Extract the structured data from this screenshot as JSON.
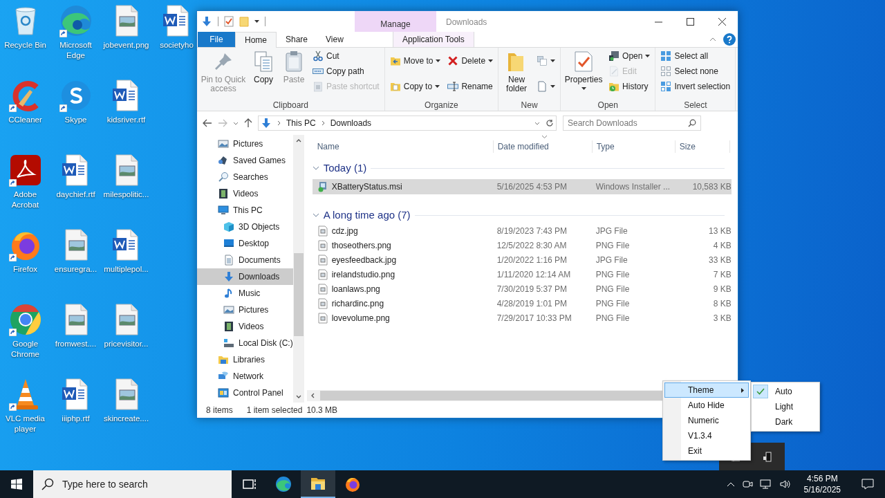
{
  "desktop": {
    "icons": [
      {
        "label": "Recycle Bin",
        "kind": "recycle",
        "shortcut": false
      },
      {
        "label": "CCleaner",
        "kind": "ccleaner",
        "shortcut": true
      },
      {
        "label": "Adobe Acrobat",
        "kind": "acrobat",
        "shortcut": true
      },
      {
        "label": "Firefox",
        "kind": "firefox",
        "shortcut": true
      },
      {
        "label": "Google Chrome",
        "kind": "chrome",
        "shortcut": true
      },
      {
        "label": "VLC media player",
        "kind": "vlc",
        "shortcut": true
      },
      {
        "label": "Microsoft Edge",
        "kind": "edge",
        "shortcut": true
      },
      {
        "label": "Skype",
        "kind": "skype",
        "shortcut": true
      },
      {
        "label": "daychief.rtf",
        "kind": "word",
        "shortcut": false
      },
      {
        "label": "ensuregra...",
        "kind": "image",
        "shortcut": false
      },
      {
        "label": "fromwest....",
        "kind": "image",
        "shortcut": false
      },
      {
        "label": "iiiphp.rtf",
        "kind": "word",
        "shortcut": false
      },
      {
        "label": "jobevent.png",
        "kind": "image",
        "shortcut": false
      },
      {
        "label": "kidsriver.rtf",
        "kind": "word",
        "shortcut": false
      },
      {
        "label": "milespolitic...",
        "kind": "image",
        "shortcut": false
      },
      {
        "label": "multiplepol...",
        "kind": "word",
        "shortcut": false
      },
      {
        "label": "pricevisitor...",
        "kind": "image",
        "shortcut": false
      },
      {
        "label": "skincreate....",
        "kind": "image",
        "shortcut": false
      },
      {
        "label": "societyho",
        "kind": "word",
        "shortcut": false
      }
    ]
  },
  "window": {
    "title": "Downloads",
    "ribbon": {
      "context_header": "Manage",
      "tabs": [
        {
          "label": "File",
          "kind": "file",
          "selected": false
        },
        {
          "label": "Home",
          "kind": "normal",
          "selected": true
        },
        {
          "label": "Share",
          "kind": "normal",
          "selected": false
        },
        {
          "label": "View",
          "kind": "normal",
          "selected": false
        },
        {
          "label": "Application Tools",
          "kind": "contextual",
          "selected": false
        }
      ],
      "groups": [
        {
          "label": "Clipboard",
          "large": [
            {
              "label": "Pin to Quick access",
              "kind": "pin",
              "disabled": true,
              "dropdown": false
            },
            {
              "label": "Copy",
              "kind": "copy",
              "disabled": false,
              "dropdown": false
            },
            {
              "label": "Paste",
              "kind": "paste",
              "disabled": true,
              "dropdown": false
            }
          ],
          "columns": [
            [
              {
                "label": "Cut",
                "kind": "cut",
                "disabled": false,
                "dropdown": false
              },
              {
                "label": "Copy path",
                "kind": "path",
                "disabled": false,
                "dropdown": false
              },
              {
                "label": "Paste shortcut",
                "kind": "shortcut",
                "disabled": true,
                "dropdown": false
              }
            ]
          ]
        },
        {
          "label": "Organize",
          "columns": [
            [
              {
                "label": "Move to",
                "kind": "move",
                "disabled": false,
                "dropdown": true
              },
              {
                "label": "Copy to",
                "kind": "copyto",
                "disabled": false,
                "dropdown": true
              }
            ],
            [
              {
                "label": "Delete",
                "kind": "delete",
                "disabled": false,
                "dropdown": true
              },
              {
                "label": "Rename",
                "kind": "rename",
                "disabled": false,
                "dropdown": false
              }
            ]
          ]
        },
        {
          "label": "New",
          "large": [
            {
              "label": "New folder",
              "kind": "folder",
              "disabled": false,
              "dropdown": false
            }
          ],
          "columns": [
            [
              {
                "kind": "newitem",
                "disabled": false,
                "dropdown": true
              },
              {
                "kind": "easyaccess",
                "disabled": false,
                "dropdown": true
              }
            ]
          ]
        },
        {
          "label": "Open",
          "large": [
            {
              "label": "Properties",
              "kind": "properties",
              "disabled": false,
              "dropdown": true
            }
          ],
          "columns": [
            [
              {
                "label": "Open",
                "kind": "open",
                "disabled": false,
                "dropdown": true
              },
              {
                "label": "Edit",
                "kind": "edit",
                "disabled": true,
                "dropdown": false
              },
              {
                "label": "History",
                "kind": "history",
                "disabled": false,
                "dropdown": false
              }
            ]
          ]
        },
        {
          "label": "Select",
          "columns": [
            [
              {
                "label": "Select all",
                "kind": "selectall",
                "disabled": false,
                "dropdown": false
              },
              {
                "label": "Select none",
                "kind": "selectnone",
                "disabled": false,
                "dropdown": false
              },
              {
                "label": "Invert selection",
                "kind": "invert",
                "disabled": false,
                "dropdown": false
              }
            ]
          ]
        }
      ]
    },
    "address": {
      "crumbs": [
        "This PC",
        "Downloads"
      ],
      "search_placeholder": "Search Downloads"
    },
    "nav_pane": {
      "items": [
        {
          "children": [
            {
              "label": "Pictures",
              "kind": "pictures",
              "selected": false
            },
            {
              "label": "Saved Games",
              "kind": "games",
              "selected": false
            },
            {
              "label": "Searches",
              "kind": "search",
              "selected": false
            },
            {
              "label": "Videos",
              "kind": "videos",
              "selected": false
            }
          ]
        },
        {
          "label": "This PC",
          "kind": "pc",
          "selected": false,
          "children": [
            {
              "label": "3D Objects",
              "kind": "cube",
              "selected": false
            },
            {
              "label": "Desktop",
              "kind": "desktop",
              "selected": false
            },
            {
              "label": "Documents",
              "kind": "documents",
              "selected": false
            },
            {
              "label": "Downloads",
              "kind": "downloads",
              "selected": true
            },
            {
              "label": "Music",
              "kind": "music",
              "selected": false
            },
            {
              "label": "Pictures",
              "kind": "pictures",
              "selected": false
            },
            {
              "label": "Videos",
              "kind": "videos",
              "selected": false
            },
            {
              "label": "Local Disk (C:)",
              "kind": "disk",
              "selected": false
            }
          ]
        },
        {
          "label": "Libraries",
          "kind": "libraries",
          "selected": false
        },
        {
          "label": "Network",
          "kind": "network",
          "selected": false
        },
        {
          "label": "Control Panel",
          "kind": "control",
          "selected": false
        }
      ]
    },
    "file_list": {
      "columns": [
        {
          "label": "Name",
          "sorted": false
        },
        {
          "label": "Date modified",
          "sorted": true
        },
        {
          "label": "Type",
          "sorted": false
        },
        {
          "label": "Size",
          "sorted": false
        }
      ],
      "groups": [
        {
          "label": "Today (1)",
          "expanded": true,
          "rows": [
            {
              "name": "XBatteryStatus.msi",
              "kind": "msi",
              "date": "5/16/2025 4:53 PM",
              "type": "Windows Installer ...",
              "size": "10,583 KB",
              "selected": true
            }
          ]
        },
        {
          "label": "A long time ago (7)",
          "expanded": true,
          "rows": [
            {
              "name": "cdz.jpg",
              "kind": "image",
              "date": "8/19/2023 7:43 PM",
              "type": "JPG File",
              "size": "13 KB",
              "selected": false
            },
            {
              "name": "thoseothers.png",
              "kind": "image",
              "date": "12/5/2022 8:30 AM",
              "type": "PNG File",
              "size": "4 KB",
              "selected": false
            },
            {
              "name": "eyesfeedback.jpg",
              "kind": "image",
              "date": "1/20/2022 1:16 PM",
              "type": "JPG File",
              "size": "33 KB",
              "selected": false
            },
            {
              "name": "irelandstudio.png",
              "kind": "image",
              "date": "1/11/2020 12:14 AM",
              "type": "PNG File",
              "size": "7 KB",
              "selected": false
            },
            {
              "name": "loanlaws.png",
              "kind": "image",
              "date": "7/30/2019 5:37 PM",
              "type": "PNG File",
              "size": "9 KB",
              "selected": false
            },
            {
              "name": "richardinc.png",
              "kind": "image",
              "date": "4/28/2019 1:01 PM",
              "type": "PNG File",
              "size": "8 KB",
              "selected": false
            },
            {
              "name": "lovevolume.png",
              "kind": "image",
              "date": "7/29/2017 10:33 PM",
              "type": "PNG File",
              "size": "3 KB",
              "selected": false
            }
          ]
        }
      ]
    },
    "status_bar": [
      "8 items",
      "1 item selected",
      "10.3 MB"
    ]
  },
  "tray_menu": {
    "items": [
      {
        "label": "Theme",
        "selected": true,
        "submenu": true
      },
      {
        "label": "Auto Hide",
        "selected": false,
        "submenu": false
      },
      {
        "label": "Numeric",
        "selected": false,
        "submenu": false
      },
      {
        "label": "V1.3.4",
        "selected": false,
        "submenu": false
      },
      {
        "label": "Exit",
        "selected": false,
        "submenu": false
      }
    ],
    "submenu": [
      {
        "label": "Auto",
        "checked": true
      },
      {
        "label": "Light",
        "checked": false
      },
      {
        "label": "Dark",
        "checked": false
      }
    ]
  },
  "taskbar": {
    "search_placeholder": "Type here to search",
    "apps": [
      {
        "kind": "taskview",
        "active": false
      },
      {
        "kind": "edge",
        "active": false
      },
      {
        "kind": "explorer",
        "active": true
      },
      {
        "kind": "firefox",
        "active": false
      }
    ],
    "clock": {
      "time": "4:56 PM",
      "date": "5/16/2025"
    }
  }
}
